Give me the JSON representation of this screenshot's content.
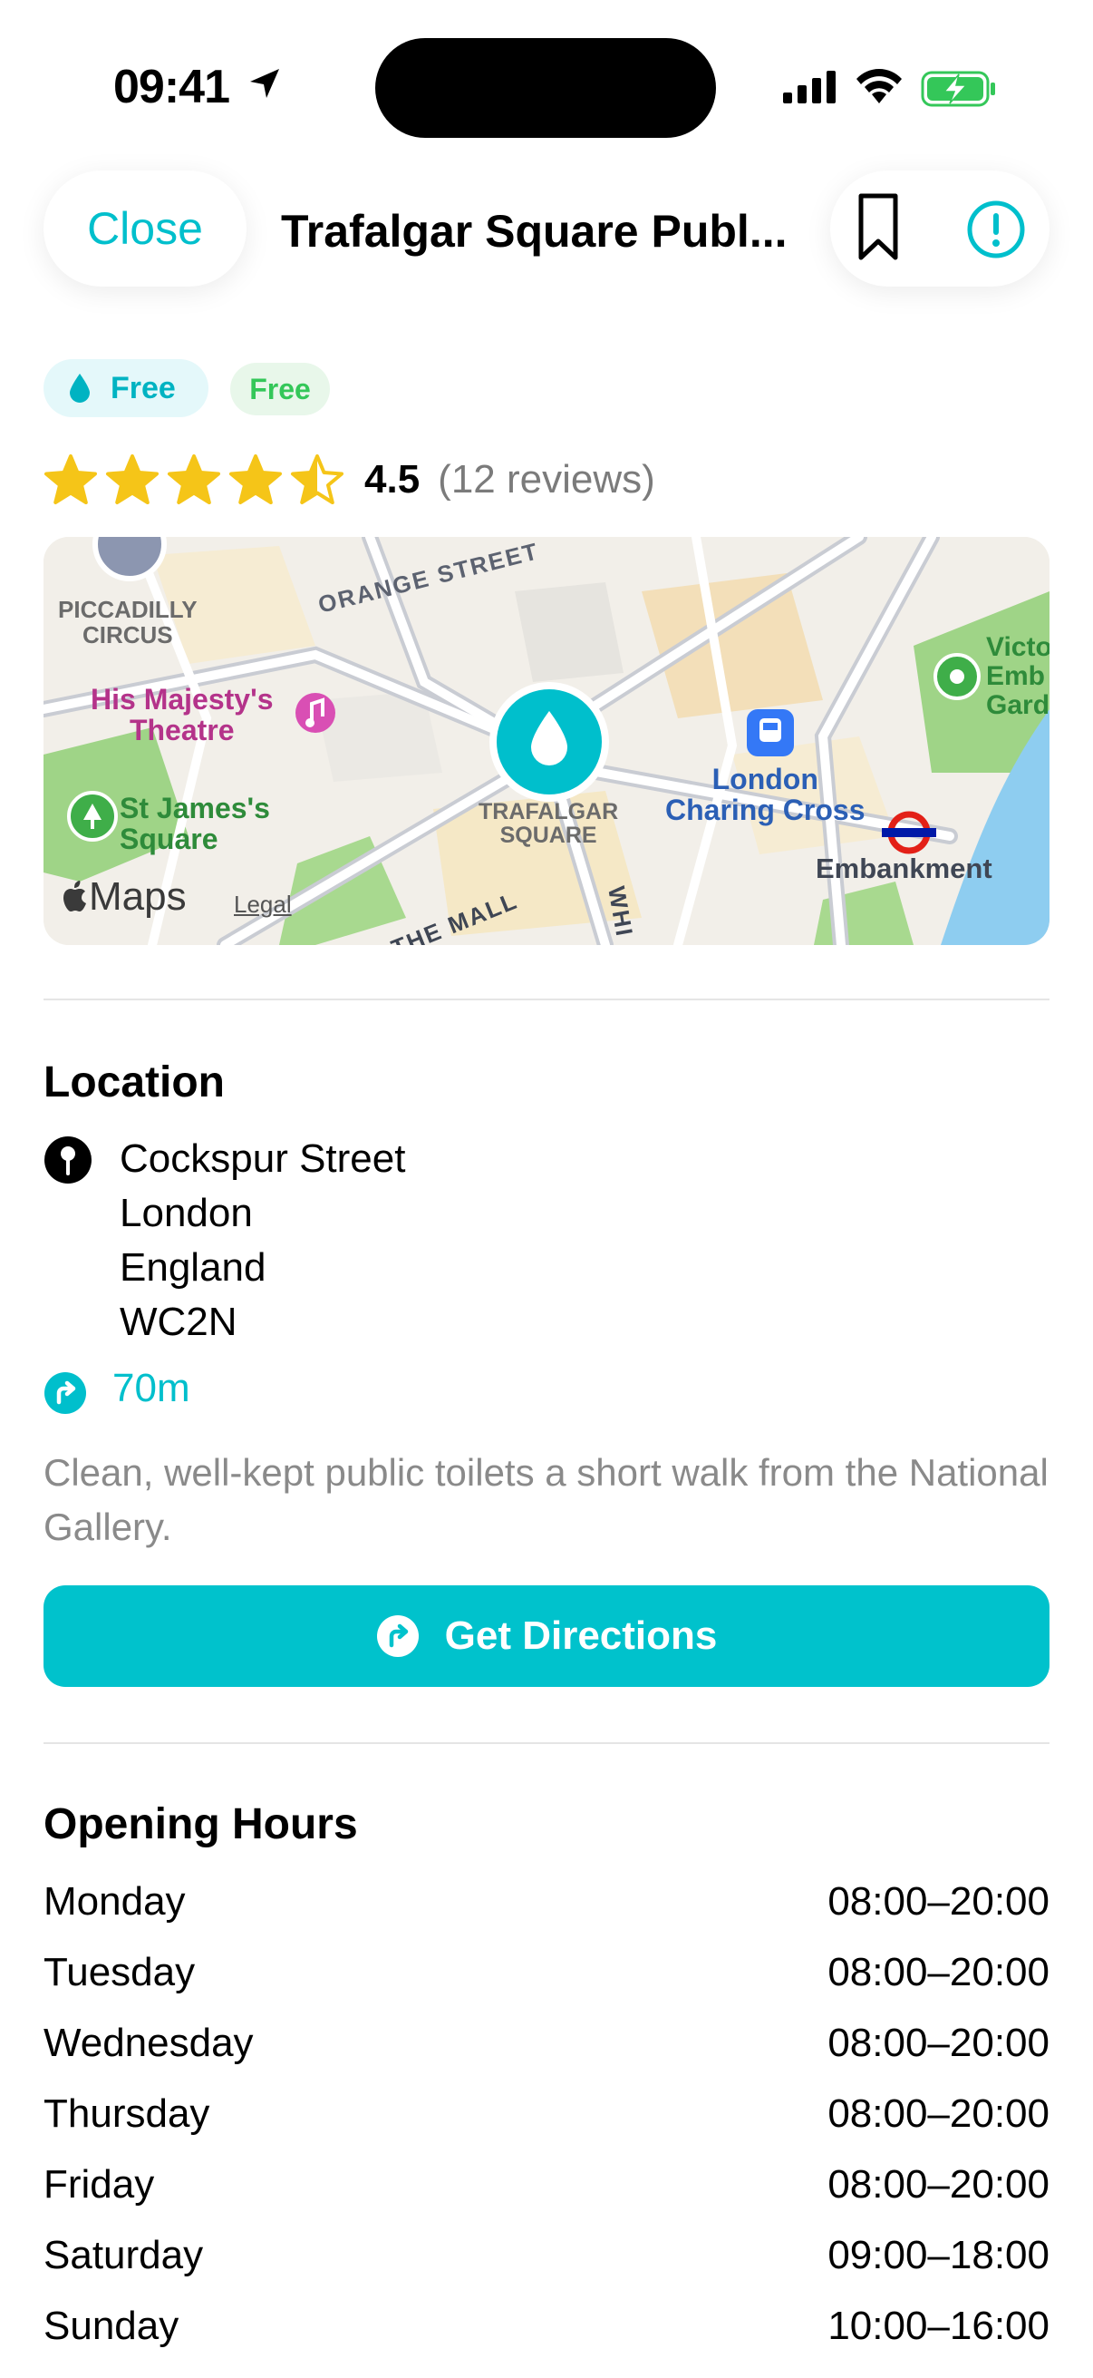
{
  "status_bar": {
    "time": "09:41"
  },
  "header": {
    "close_label": "Close",
    "title": "Trafalgar Square Publ..."
  },
  "icons": {
    "location": "location-arrow-icon",
    "bookmark": "bookmark-icon",
    "info": "info-icon",
    "water": "water-drop-icon",
    "pin": "map-pin-icon",
    "directions": "turn-right-icon"
  },
  "badges": {
    "water_label": "Free",
    "free_label": "Free"
  },
  "rating": {
    "value": "4.5",
    "stars": 4.5,
    "reviews": "(12 reviews)"
  },
  "map": {
    "labels": {
      "piccadilly": "PICCADILLY\nCIRCUS",
      "orange_street": "ORANGE STREET",
      "majesty": "His Majesty's\nTheatre",
      "st_james": "St James's\nSquare",
      "trafalgar": "TRAFALGAR\nSQUARE",
      "charing": "London\nCharing Cross",
      "embankment": "Embankment",
      "victoria": "Victo\nEmb\nGard",
      "mall": "THE MALL",
      "whitehall": "WHI"
    },
    "brand": "Maps",
    "legal": "Legal"
  },
  "location": {
    "title": "Location",
    "address": [
      "Cockspur Street",
      "London",
      "England",
      "WC2N"
    ],
    "distance": "70m",
    "description": "Clean, well-kept public toilets a short walk from the National Gallery.",
    "directions_label": "Get Directions"
  },
  "hours": {
    "title": "Opening Hours",
    "rows": [
      {
        "day": "Monday",
        "time": "08:00–20:00"
      },
      {
        "day": "Tuesday",
        "time": "08:00–20:00"
      },
      {
        "day": "Wednesday",
        "time": "08:00–20:00"
      },
      {
        "day": "Thursday",
        "time": "08:00–20:00"
      },
      {
        "day": "Friday",
        "time": "08:00–20:00"
      },
      {
        "day": "Saturday",
        "time": "09:00–18:00"
      },
      {
        "day": "Sunday",
        "time": "10:00–16:00"
      }
    ]
  },
  "colors": {
    "accent": "#00c2cc",
    "star": "#f5c518",
    "free_green": "#34c759"
  }
}
